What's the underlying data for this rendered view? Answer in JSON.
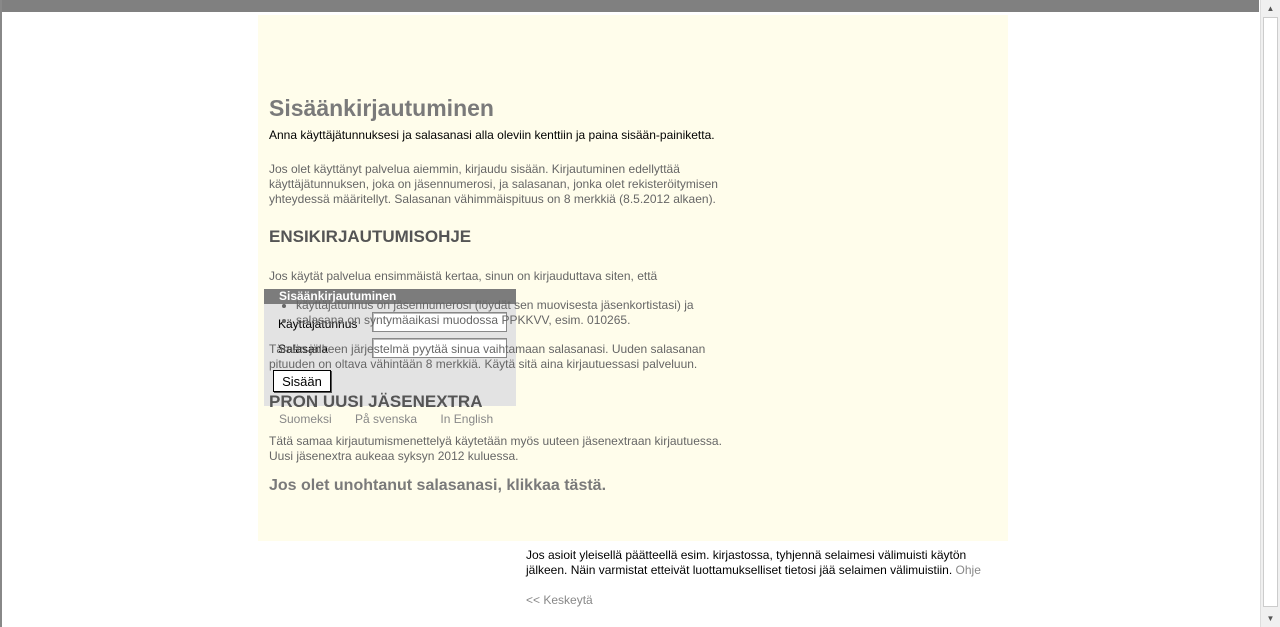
{
  "login": {
    "title": "Sisäänkirjautuminen",
    "username_label": "Käyttäjätunnus",
    "password_label": "Salasana",
    "username_value": "",
    "password_value": "",
    "submit": "Sisään"
  },
  "languages": [
    "Suomeksi",
    "På svenska",
    "In English"
  ],
  "main": {
    "title": "Sisäänkirjautuminen",
    "intro": "Anna käyttäjätunnuksesi ja salasanasi alla oleviin kenttiin ja paina sisään-painiketta.",
    "p1": "Jos olet käyttänyt palvelua aiemmin, kirjaudu sisään. Kirjautuminen edellyttää käyttäjätunnuksen, joka on jäsennumerosi, ja salasanan, jonka olet rekisteröitymisen yhteydessä määritellyt. Salasanan vähimmäispituus on 8 merkkiä (8.5.2012 alkaen).",
    "h2a": "ENSIKIRJAUTUMISOHJE",
    "p2": "Jos käytät palvelua ensimmäistä kertaa, sinun on kirjauduttava siten, että",
    "bullets": [
      "käyttäjätunnus on jäsennumerosi (löydät sen muovisesta jäsenkortistasi) ja",
      "salasana on syntymäaikasi muodossa PPKKVV, esim. 010265."
    ],
    "p3": "Tämän jälkeen järjestelmä pyytää sinua vaihtamaan salasanasi. Uuden salasanan pituuden on oltava vähintään 8 merkkiä. Käytä sitä aina kirjautuessasi palveluun.",
    "h2b": "PRON UUSI JÄSENEXTRA",
    "p4": "Tätä samaa kirjautumismenettelyä käytetään myös uuteen jäsenextraan kirjautuessa. Uusi jäsenextra aukeaa syksyn 2012 kuluessa.",
    "forgot": "Jos olet unohtanut salasanasi, klikkaa tästä."
  },
  "footer": {
    "note": "Jos asioit yleisellä päätteellä esim. kirjastossa, tyhjennä selaimesi välimuisti käytön jälkeen. Näin varmistat etteivät luottamukselliset tietosi jää selaimen välimuistiin.",
    "help": "Ohje",
    "cancel": "<< Keskeytä"
  }
}
